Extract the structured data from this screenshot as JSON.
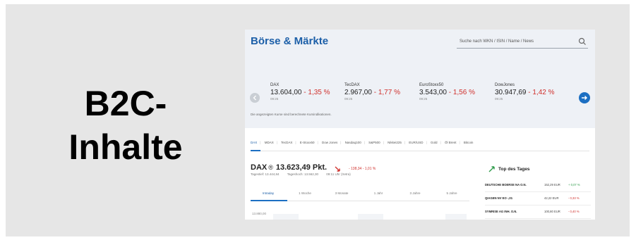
{
  "slide": {
    "title": "B2C-Inhalte"
  },
  "site": {
    "title": "Börse & Märkte",
    "search": {
      "placeholder": "Suche nach WKN / ISIN / Name / News"
    }
  },
  "tickers": [
    {
      "name": "DAX",
      "value": "13.604,00",
      "change": "- 1,35 %",
      "time": "09:25"
    },
    {
      "name": "TecDAX",
      "value": "2.967,00",
      "change": "- 1,77 %",
      "time": "09:25"
    },
    {
      "name": "EuroStoxx50",
      "value": "3.543,00",
      "change": "- 1,56 %",
      "time": "09:25"
    },
    {
      "name": "DowJones",
      "value": "30.947,69",
      "change": "- 1,42 %",
      "time": "09:25"
    }
  ],
  "ticker_note": "Die angezeigten Kurse sind berechnete Kursindikationen.",
  "index_tabs": [
    "DAX",
    "MDAX",
    "TecDAX",
    "E-Stoxx50",
    "Dow Jones",
    "Nasdaq100",
    "S&P500",
    "Nikkei225",
    "EUR/USD",
    "Gold",
    "Öl Brent",
    "Bitcoin"
  ],
  "dax": {
    "name": "DAX",
    "registered": "®",
    "points": "13.623,49 Pkt.",
    "change": "- 138,34 - 1,01 %",
    "low_label": "Tagestief: 13.444,84",
    "high_label": "Tageshoch: 13.562,30",
    "time": "09:11 Uhr (Xetra)"
  },
  "periods": [
    "Intraday",
    "1 Woche",
    "3 Monate",
    "1 Jahr",
    "3 Jahre",
    "5 Jahre"
  ],
  "chart_axis_label": "13.880,00",
  "top_des_tages": {
    "title": "Top des Tages",
    "rows": [
      {
        "name": "DEUTSCHE BOERSE NA O.N.",
        "price": "152,29 EUR",
        "change": "+ 0,07 %",
        "dir": "pos"
      },
      {
        "name": "QIAGEN NV EO -,01",
        "price": "42,22 EUR",
        "change": "- 0,33 %",
        "dir": "neg"
      },
      {
        "name": "SYMRISE AG INH. O.N.",
        "price": "100,80 EUR",
        "change": "- 0,40 %",
        "dir": "neg"
      }
    ]
  },
  "colors": {
    "accent": "#1c5fa8",
    "negative": "#d0312d",
    "positive": "#2e9b4a"
  }
}
